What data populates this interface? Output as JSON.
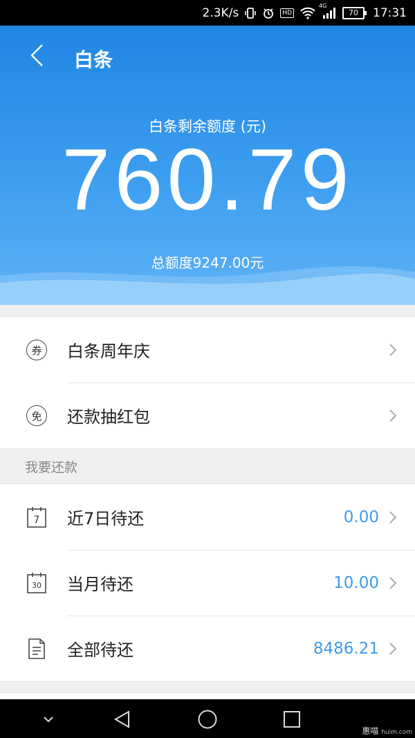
{
  "status_bar": {
    "speed": "2.3K/s",
    "hd": "HD",
    "network": "4G",
    "battery": "70",
    "time": "17:31"
  },
  "header": {
    "title": "白条",
    "balance_label": "白条剩余额度 (元)",
    "balance": "760.79",
    "total": "总额度9247.00元"
  },
  "promos": [
    {
      "icon_char": "券",
      "label": "白条周年庆"
    },
    {
      "icon_char": "免",
      "label": "还款抽红包"
    }
  ],
  "repay": {
    "section_title": "我要还款",
    "items": [
      {
        "icon_char": "7",
        "label": "近7日待还",
        "value": "0.00"
      },
      {
        "icon_char": "30",
        "label": "当月待还",
        "value": "10.00"
      },
      {
        "label": "全部待还",
        "value": "8486.21"
      }
    ]
  },
  "watermark": {
    "brand": "惠喵",
    "domain": "huim.com"
  },
  "colors": {
    "header_top": "#1f86e3",
    "header_bottom": "#5fb2f6",
    "value_blue": "#3f9be8"
  }
}
